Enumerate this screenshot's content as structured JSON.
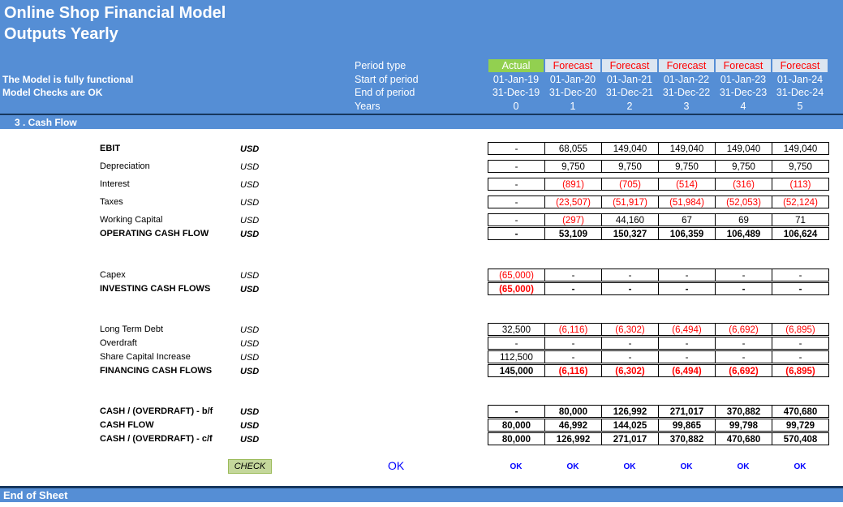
{
  "title_line1": "Online Shop Financial Model",
  "title_line2": "Outputs Yearly",
  "status": [
    "The Model is fully functional",
    "Model Checks are OK"
  ],
  "period_labels": [
    "Period type",
    "Start of period",
    "End of period",
    "Years"
  ],
  "columns": [
    {
      "type": "Actual",
      "start": "01-Jan-19",
      "end": "31-Dec-19",
      "year": "0"
    },
    {
      "type": "Forecast",
      "start": "01-Jan-20",
      "end": "31-Dec-20",
      "year": "1"
    },
    {
      "type": "Forecast",
      "start": "01-Jan-21",
      "end": "31-Dec-21",
      "year": "2"
    },
    {
      "type": "Forecast",
      "start": "01-Jan-22",
      "end": "31-Dec-22",
      "year": "3"
    },
    {
      "type": "Forecast",
      "start": "01-Jan-23",
      "end": "31-Dec-23",
      "year": "4"
    },
    {
      "type": "Forecast",
      "start": "01-Jan-24",
      "end": "31-Dec-24",
      "year": "5"
    }
  ],
  "section_title": "3 . Cash Flow",
  "rows": [
    {
      "label": "EBIT",
      "unit": "USD",
      "bold": true,
      "values": [
        "-",
        "68,055",
        "149,040",
        "149,040",
        "149,040",
        "149,040"
      ]
    },
    {
      "label": "Depreciation",
      "unit": "USD",
      "bold": false,
      "values": [
        "-",
        "9,750",
        "9,750",
        "9,750",
        "9,750",
        "9,750"
      ]
    },
    {
      "label": "Interest",
      "unit": "USD",
      "bold": false,
      "values": [
        "-",
        "(891)",
        "(705)",
        "(514)",
        "(316)",
        "(113)"
      ]
    },
    {
      "label": "Taxes",
      "unit": "USD",
      "bold": false,
      "values": [
        "-",
        "(23,507)",
        "(51,917)",
        "(51,984)",
        "(52,053)",
        "(52,124)"
      ]
    },
    {
      "label": "Working Capital",
      "unit": "USD",
      "bold": false,
      "values": [
        "-",
        "(297)",
        "44,160",
        "67",
        "69",
        "71"
      ]
    },
    {
      "label": "OPERATING CASH FLOW",
      "unit": "USD",
      "bold": true,
      "values": [
        "-",
        "53,109",
        "150,327",
        "106,359",
        "106,489",
        "106,624"
      ]
    },
    {
      "label": "Capex",
      "unit": "USD",
      "bold": false,
      "values": [
        "(65,000)",
        "-",
        "-",
        "-",
        "-",
        "-"
      ]
    },
    {
      "label": "INVESTING CASH FLOWS",
      "unit": "USD",
      "bold": true,
      "values": [
        "(65,000)",
        "-",
        "-",
        "-",
        "-",
        "-"
      ]
    },
    {
      "label": "Long Term Debt",
      "unit": "USD",
      "bold": false,
      "values": [
        "32,500",
        "(6,116)",
        "(6,302)",
        "(6,494)",
        "(6,692)",
        "(6,895)"
      ]
    },
    {
      "label": "Overdraft",
      "unit": "USD",
      "bold": false,
      "values": [
        "-",
        "-",
        "-",
        "-",
        "-",
        "-"
      ]
    },
    {
      "label": "Share Capital Increase",
      "unit": "USD",
      "bold": false,
      "values": [
        "112,500",
        "-",
        "-",
        "-",
        "-",
        "-"
      ]
    },
    {
      "label": "FINANCING CASH FLOWS",
      "unit": "USD",
      "bold": true,
      "values": [
        "145,000",
        "(6,116)",
        "(6,302)",
        "(6,494)",
        "(6,692)",
        "(6,895)"
      ]
    },
    {
      "label": "CASH / (OVERDRAFT) - b/f",
      "unit": "USD",
      "bold": true,
      "values": [
        "-",
        "80,000",
        "126,992",
        "271,017",
        "370,882",
        "470,680"
      ]
    },
    {
      "label": "CASH FLOW",
      "unit": "USD",
      "bold": true,
      "values": [
        "80,000",
        "46,992",
        "144,025",
        "99,865",
        "99,798",
        "99,729"
      ]
    },
    {
      "label": "CASH / (OVERDRAFT) - c/f",
      "unit": "USD",
      "bold": true,
      "values": [
        "80,000",
        "126,992",
        "271,017",
        "370,882",
        "470,680",
        "570,408"
      ]
    }
  ],
  "check_label": "CHECK",
  "check_result": "OK",
  "column_checks": [
    "OK",
    "OK",
    "OK",
    "OK",
    "OK",
    "OK"
  ],
  "footer": "End of Sheet",
  "colors": {
    "header": "#558ed5",
    "actual": "#92d050",
    "forecast_bg": "#dce6f1",
    "negative": "#ff0000",
    "ok": "#0000ff"
  }
}
